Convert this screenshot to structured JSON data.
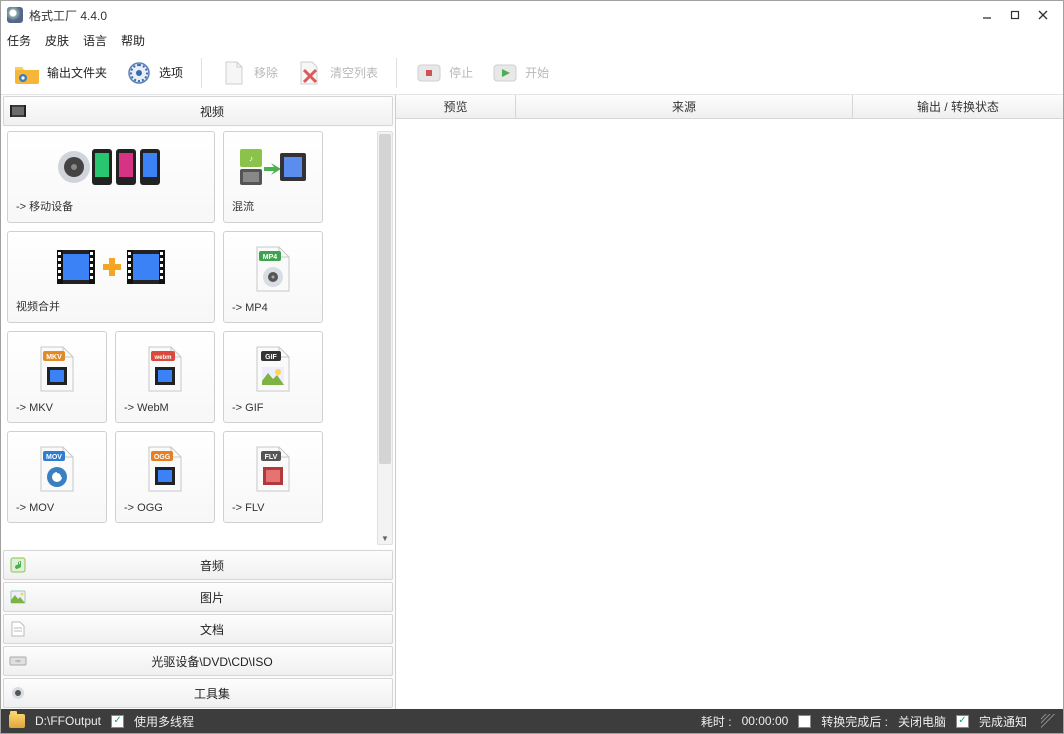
{
  "app": {
    "title": "格式工厂 4.4.0"
  },
  "menu": {
    "task": "任务",
    "skin": "皮肤",
    "language": "语言",
    "help": "帮助"
  },
  "toolbar": {
    "output_folder": "输出文件夹",
    "options": "选项",
    "remove": "移除",
    "clear_list": "清空列表",
    "stop": "停止",
    "start": "开始"
  },
  "categories": {
    "video": "视频",
    "audio": "音频",
    "image": "图片",
    "document": "文档",
    "drive": "光驱设备\\DVD\\CD\\ISO",
    "tools": "工具集"
  },
  "tiles": {
    "mobile": "-> 移动设备",
    "mux": "混流",
    "merge": "视频合并",
    "mp4": "-> MP4",
    "mkv": "-> MKV",
    "webm": "-> WebM",
    "gif": "-> GIF",
    "mov": "-> MOV",
    "ogg": "-> OGG",
    "flv": "-> FLV"
  },
  "table": {
    "preview": "预览",
    "source": "来源",
    "status": "输出 / 转换状态"
  },
  "status": {
    "output_path": "D:\\FFOutput",
    "multithread": "使用多线程",
    "elapsed_label": "耗时 :",
    "elapsed_value": "00:00:00",
    "after_convert": "转换完成后 :",
    "shutdown": "关闭电脑",
    "notify": "完成通知"
  }
}
